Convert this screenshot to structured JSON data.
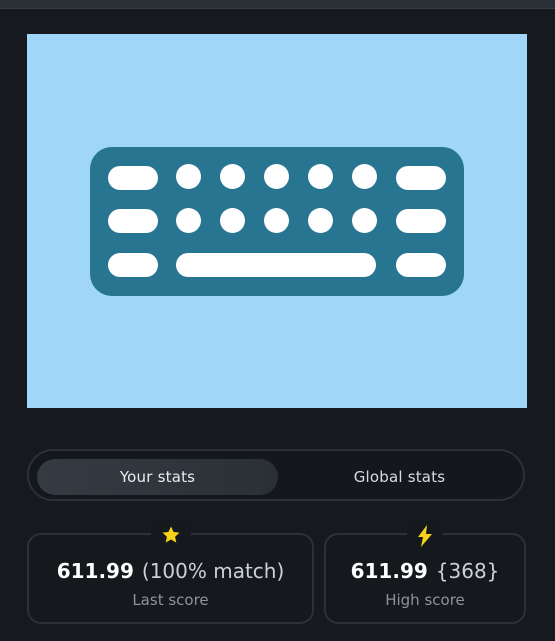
{
  "hero": {
    "image_label": "keyboard-icon",
    "colors": {
      "background": "#a0d7f8",
      "keyboard": "#287592",
      "keys": "#ffffff"
    }
  },
  "tabs": [
    {
      "label": "Your stats",
      "active": true
    },
    {
      "label": "Global stats",
      "active": false
    }
  ],
  "stats": {
    "last": {
      "icon": "star-icon",
      "score": "611.99",
      "detail": "(100% match)",
      "caption": "Last score"
    },
    "high": {
      "icon": "bolt-icon",
      "score": "611.99",
      "detail": "{368}",
      "caption": "High score"
    }
  },
  "colors": {
    "accent_yellow": "#f6d21a"
  }
}
